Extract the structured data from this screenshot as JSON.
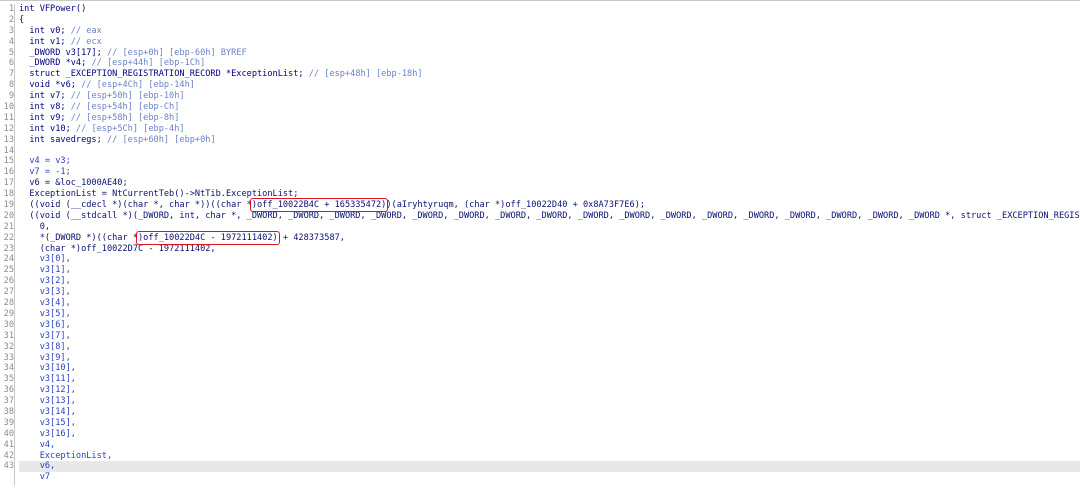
{
  "lines": [
    {
      "n": "1",
      "parts": [
        {
          "t": "int VFPower()",
          "c": "k"
        }
      ]
    },
    {
      "n": "2",
      "parts": [
        {
          "t": "{",
          "c": "k"
        }
      ]
    },
    {
      "n": "3",
      "parts": [
        {
          "t": "  int v0; ",
          "c": "k"
        },
        {
          "t": "// eax",
          "c": "c"
        }
      ]
    },
    {
      "n": "4",
      "parts": [
        {
          "t": "  int v1; ",
          "c": "k"
        },
        {
          "t": "// ecx",
          "c": "c"
        }
      ]
    },
    {
      "n": "5",
      "parts": [
        {
          "t": "  _DWORD v3[17]; ",
          "c": "k"
        },
        {
          "t": "// [esp+0h] [ebp-60h] BYREF",
          "c": "c"
        }
      ]
    },
    {
      "n": "6",
      "parts": [
        {
          "t": "  _DWORD *v4; ",
          "c": "k"
        },
        {
          "t": "// [esp+44h] [ebp-1Ch]",
          "c": "c"
        }
      ]
    },
    {
      "n": "7",
      "parts": [
        {
          "t": "  struct _EXCEPTION_REGISTRATION_RECORD *ExceptionList; ",
          "c": "k"
        },
        {
          "t": "// [esp+48h] [ebp-18h]",
          "c": "c"
        }
      ]
    },
    {
      "n": "8",
      "parts": [
        {
          "t": "  void *v6; ",
          "c": "k"
        },
        {
          "t": "// [esp+4Ch] [ebp-14h]",
          "c": "c"
        }
      ]
    },
    {
      "n": "9",
      "parts": [
        {
          "t": "  int v7; ",
          "c": "k"
        },
        {
          "t": "// [esp+50h] [ebp-10h]",
          "c": "c"
        }
      ]
    },
    {
      "n": "10",
      "parts": [
        {
          "t": "  int v8; ",
          "c": "k"
        },
        {
          "t": "// [esp+54h] [ebp-Ch]",
          "c": "c"
        }
      ]
    },
    {
      "n": "11",
      "parts": [
        {
          "t": "  int v9; ",
          "c": "k"
        },
        {
          "t": "// [esp+58h] [ebp-8h]",
          "c": "c"
        }
      ]
    },
    {
      "n": "12",
      "parts": [
        {
          "t": "  int v10; ",
          "c": "k"
        },
        {
          "t": "// [esp+5Ch] [ebp-4h]",
          "c": "c"
        }
      ]
    },
    {
      "n": "13",
      "parts": [
        {
          "t": "  int savedregs; ",
          "c": "k"
        },
        {
          "t": "// [esp+60h] [ebp+0h]",
          "c": "c"
        }
      ]
    },
    {
      "n": "14",
      "parts": []
    },
    {
      "n": "15",
      "parts": [
        {
          "t": "  v4 = v3;",
          "c": "v"
        }
      ]
    },
    {
      "n": "16",
      "parts": [
        {
          "t": "  v7 = -1;",
          "c": "v"
        }
      ]
    },
    {
      "n": "17",
      "parts": [
        {
          "t": "  v6 = &loc_1000AE40;",
          "c": "n"
        }
      ]
    },
    {
      "n": "18",
      "parts": [
        {
          "t": "  ExceptionList = NtCurrentTeb()->NtTib.ExceptionList;",
          "c": "n"
        }
      ]
    },
    {
      "n": "19",
      "parts": [
        {
          "t": "  ((void (__cdecl *)(char *, char *))((char *",
          "c": "n"
        },
        {
          "t": ")off_10022B4C + 165335472)",
          "c": "n",
          "box": true
        },
        {
          "t": ")(aIryhtyruqm, (char *)off_10022D40 + 0x8A73F7E6);",
          "c": "n"
        }
      ]
    },
    {
      "n": "20",
      "parts": [
        {
          "t": "  ((void (__stdcall *)(_DWORD, int, char *, _DWORD, _DWORD, _DWORD, _DWORD, _DWORD, _DWORD, _DWORD, _DWORD, _DWORD, _DWORD, _DWORD, _DWORD, _DWORD, _DWORD, _DWORD, _DWORD, _DWORD *, struct _EXCEPTION_REGISTRATION_RECORD *",
          "c": "n"
        }
      ]
    },
    {
      "n": "21",
      "parts": [
        {
          "t": "    0,",
          "c": "n"
        }
      ]
    },
    {
      "n": "22",
      "parts": [
        {
          "t": "    *(_DWORD *)((char *",
          "c": "n"
        },
        {
          "t": ")off_10022D4C - 1972111402)",
          "c": "n",
          "box": true
        },
        {
          "t": " + 428373587,",
          "c": "n"
        }
      ]
    },
    {
      "n": "23",
      "parts": [
        {
          "t": "    (char *)off_10022D7C - 1972111402,",
          "c": "n"
        }
      ]
    },
    {
      "n": "24",
      "parts": [
        {
          "t": "    v3[0],",
          "c": "v"
        }
      ]
    },
    {
      "n": "25",
      "parts": [
        {
          "t": "    v3[1],",
          "c": "v"
        }
      ]
    },
    {
      "n": "26",
      "parts": [
        {
          "t": "    v3[2],",
          "c": "v"
        }
      ]
    },
    {
      "n": "27",
      "parts": [
        {
          "t": "    v3[3],",
          "c": "v"
        }
      ]
    },
    {
      "n": "28",
      "parts": [
        {
          "t": "    v3[4],",
          "c": "v"
        }
      ]
    },
    {
      "n": "29",
      "parts": [
        {
          "t": "    v3[5],",
          "c": "v"
        }
      ]
    },
    {
      "n": "30",
      "parts": [
        {
          "t": "    v3[6],",
          "c": "v"
        }
      ]
    },
    {
      "n": "31",
      "parts": [
        {
          "t": "    v3[7],",
          "c": "v"
        }
      ]
    },
    {
      "n": "32",
      "parts": [
        {
          "t": "    v3[8],",
          "c": "v"
        }
      ]
    },
    {
      "n": "33",
      "parts": [
        {
          "t": "    v3[9],",
          "c": "v"
        }
      ]
    },
    {
      "n": "34",
      "parts": [
        {
          "t": "    v3[10],",
          "c": "v"
        }
      ]
    },
    {
      "n": "35",
      "parts": [
        {
          "t": "    v3[11],",
          "c": "v"
        }
      ]
    },
    {
      "n": "36",
      "parts": [
        {
          "t": "    v3[12],",
          "c": "v"
        }
      ]
    },
    {
      "n": "37",
      "parts": [
        {
          "t": "    v3[13],",
          "c": "v"
        }
      ]
    },
    {
      "n": "38",
      "parts": [
        {
          "t": "    v3[14],",
          "c": "v"
        }
      ]
    },
    {
      "n": "39",
      "parts": [
        {
          "t": "    v3[15],",
          "c": "v"
        }
      ]
    },
    {
      "n": "40",
      "parts": [
        {
          "t": "    v3[16],",
          "c": "v"
        }
      ]
    },
    {
      "n": "41",
      "parts": [
        {
          "t": "    v4,",
          "c": "v"
        }
      ]
    },
    {
      "n": "42",
      "parts": [
        {
          "t": "    ExceptionList,",
          "c": "v"
        }
      ]
    },
    {
      "n": "43",
      "parts": [
        {
          "t": "    v6,",
          "c": "v"
        }
      ],
      "highlight": true
    },
    {
      "n": "",
      "parts": [
        {
          "t": "    v7",
          "c": "v"
        }
      ]
    }
  ],
  "colors": {
    "keyword": "#000080",
    "comment": "#6b82c8",
    "variable": "#2a3fbd",
    "annotation_box": "#e0141e",
    "current_line": "#e8e8e8"
  }
}
